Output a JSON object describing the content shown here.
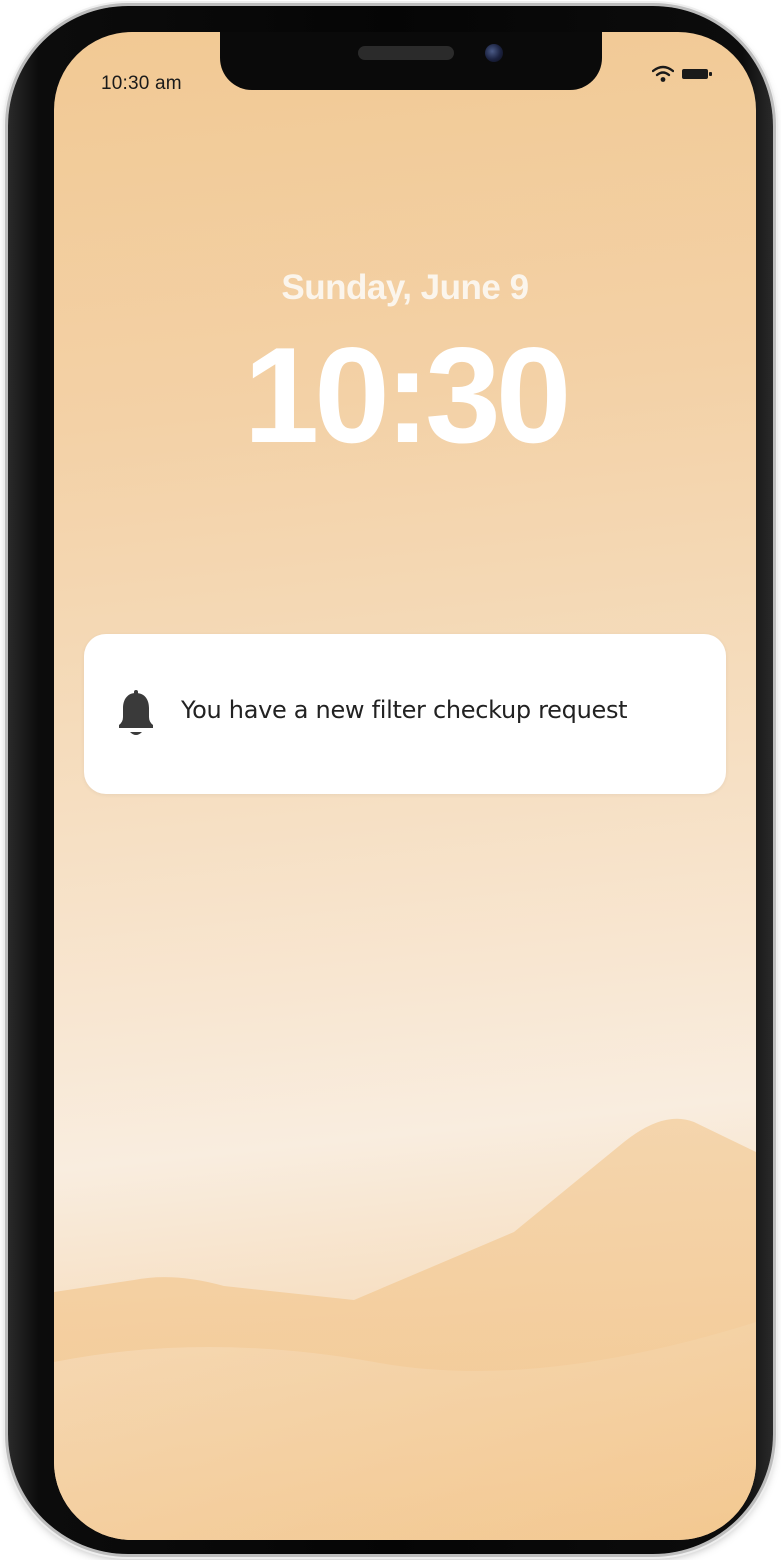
{
  "status_bar": {
    "time": "10:30 am",
    "icons": [
      "wifi-icon",
      "battery-icon"
    ]
  },
  "lock_screen": {
    "date": "Sunday, June 9",
    "time": "10:30"
  },
  "notification": {
    "icon": "bell-icon",
    "message": "You have a new filter checkup request"
  },
  "colors": {
    "wallpaper_top": "#f2c994",
    "wallpaper_mid": "#f9eddf",
    "wallpaper_bottom": "#f3c98f",
    "notification_background": "#ffffff",
    "bell": "#3a3a3a",
    "phone_frame": "#0a0a0a"
  }
}
